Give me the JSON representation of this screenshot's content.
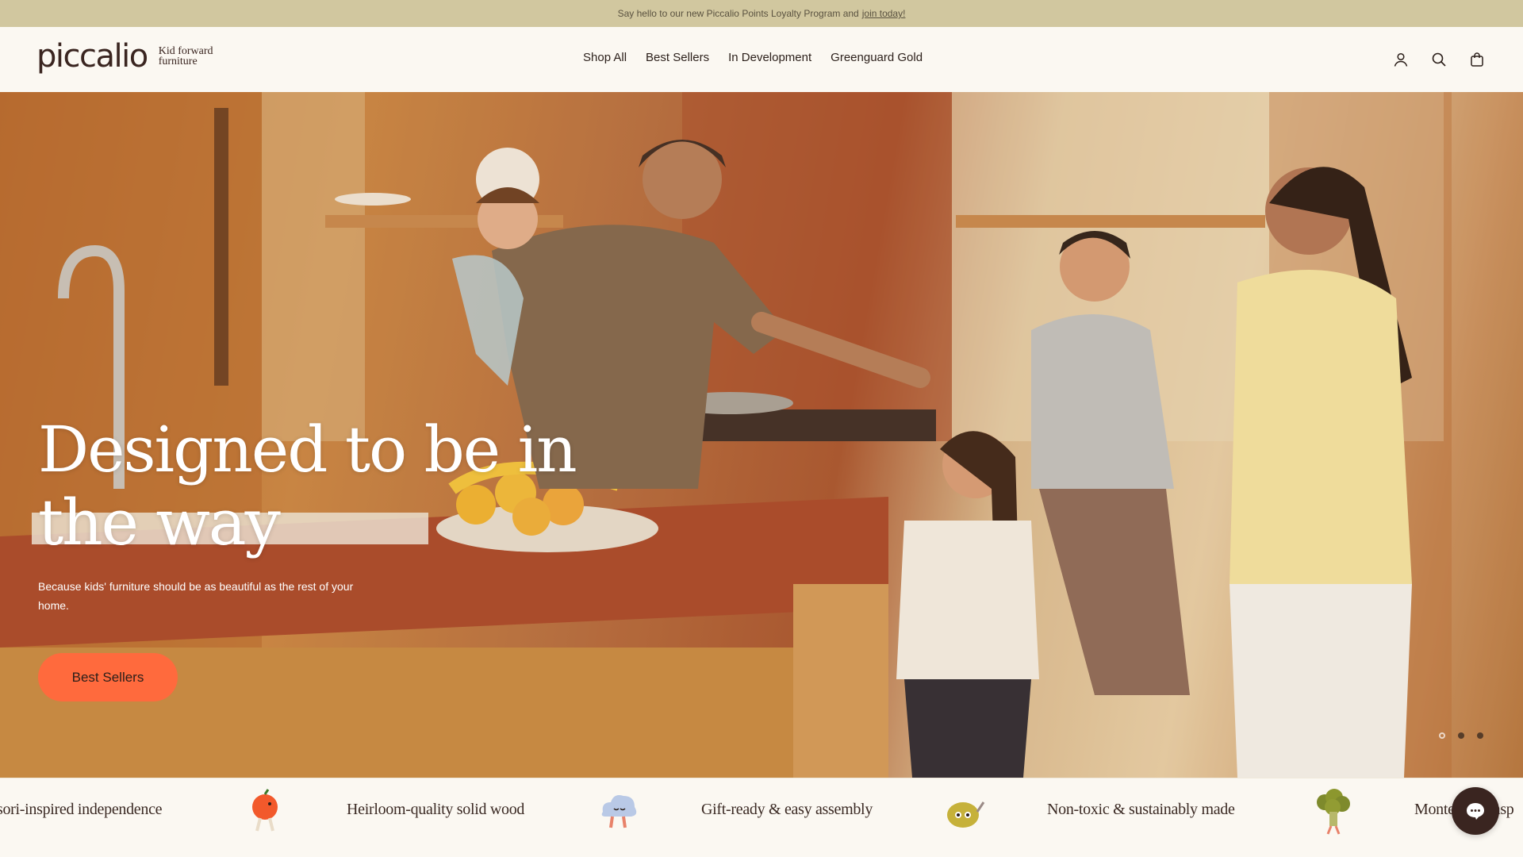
{
  "announcement": {
    "text": "Say hello to our new Piccalio Points Loyalty Program and",
    "link": "join today!"
  },
  "header": {
    "logo": "piccalio",
    "tagline_1": "Kid forward",
    "tagline_2": "furniture",
    "nav": [
      "Shop All",
      "Best Sellers",
      "In Development",
      "Greenguard Gold"
    ],
    "icons": [
      "account-icon",
      "search-icon",
      "cart-icon"
    ]
  },
  "hero": {
    "title": "Designed to be in the way",
    "subtitle": "Because kids' furniture should be as beautiful as the rest of your home.",
    "cta": "Best Sellers",
    "slides": 3,
    "active_slide": 1
  },
  "marquee": {
    "items": [
      "sori-inspired independence",
      "Heirloom-quality solid wood",
      "Gift-ready & easy assembly",
      "Non-toxic & sustainably made",
      "Montessori-insp"
    ],
    "icons": [
      "orange-character-icon",
      "cloud-character-icon",
      "teapot-character-icon",
      "broccoli-character-icon"
    ]
  },
  "colors": {
    "announcement_bg": "#d1c79f",
    "cta": "#ff6a3d",
    "brand_dark": "#3a2520",
    "page_bg": "#fbf8f2"
  }
}
